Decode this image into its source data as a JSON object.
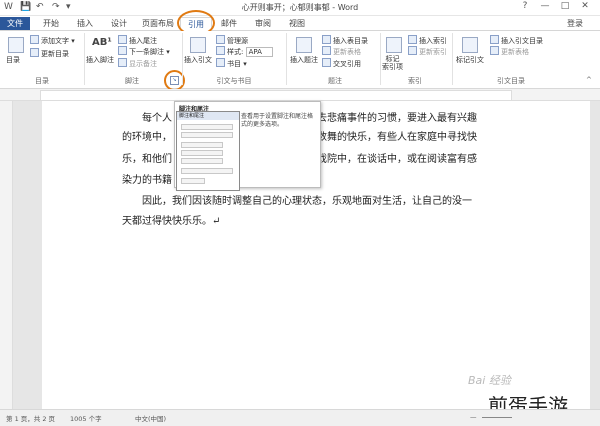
{
  "titlebar": {
    "title": "心开则事开；心郁则事郁 - Word",
    "qat": [
      "W",
      "💾",
      "↶",
      "↷",
      "▾"
    ],
    "help": "?",
    "minimize": "—",
    "restore": "□",
    "close": "✕"
  },
  "tabs": {
    "items": [
      "文件",
      "开始",
      "插入",
      "设计",
      "页面布局",
      "引用",
      "邮件",
      "审阅",
      "视图"
    ],
    "active": "引用",
    "login": "登录"
  },
  "ribbon": {
    "toc": {
      "button": "目录",
      "add_text": "添加文字 ▾",
      "update": "更新目录",
      "group": "目录"
    },
    "footnotes": {
      "insert_footnote": "插入脚注",
      "insert_endnote": "插入尾注",
      "next_footnote": "下一条脚注 ▾",
      "show_notes": "显示备注",
      "group": "脚注",
      "ab_label": "AB¹"
    },
    "citations": {
      "insert_citation": "插入引文",
      "manage_sources": "管理源",
      "style_label": "样式:",
      "style_value": "APA",
      "bibliography": "书目 ▾",
      "group": "引文与书目"
    },
    "captions": {
      "insert_caption": "插入题注",
      "insert_table_of_figures": "插入表目录",
      "update_table": "更新表格",
      "cross_ref": "交叉引用",
      "group": "题注"
    },
    "index": {
      "mark_entry": "标记\n索引项",
      "insert_index": "插入索引",
      "update_index": "更新索引",
      "group": "索引"
    },
    "toa": {
      "mark_citation": "标记引文",
      "insert_toa": "插入引文目录",
      "update_table": "更新表格",
      "group": "引文目录"
    }
  },
  "document": {
    "paragraphs": [
      "每个人",
      "去悲痛事件的习惯，要进入最有兴趣",
      "的环境中，",
      "数舞的快乐，有些人在家庭中寻找快",
      "乐，和他们",
      "戏院中，在谈话中，或在阅读富有感",
      "染力的书籍",
      "因此，我们因该随时调整自己的心理状态，乐观地面对生活，让自己的没一",
      "天都过得快快乐乐。↵"
    ]
  },
  "dialog": {
    "title": "脚注和尾注",
    "tooltip_title": "脚注和尾注",
    "tooltip_desc": "查看用于设置脚注和尾注格式的更多选项。"
  },
  "status": {
    "page": "第 1 页，共 2 页",
    "words": "1005 个字",
    "lang": "中文(中国)",
    "zoom": "+",
    "zoom_out": "—"
  },
  "watermark": {
    "text": "煎蛋手游",
    "site": "Bai 经验"
  }
}
